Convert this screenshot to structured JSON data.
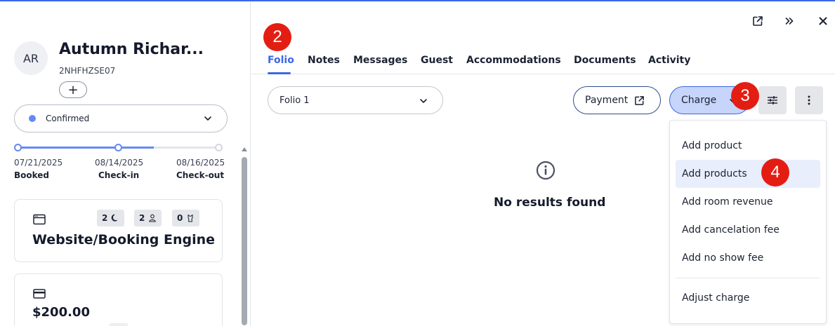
{
  "reservation": {
    "avatar_initials": "AR",
    "guest_name": "Autumn Richar...",
    "booking_code": "2NHFHZSE07",
    "add_label": "+",
    "status": {
      "label": "Confirmed",
      "color": "#6689f2"
    },
    "timeline": {
      "progress_fraction": 0.67,
      "booked_date": "07/21/2025",
      "booked_label": "Booked",
      "checkin_date": "08/14/2025",
      "checkin_label": "Check-in",
      "checkout_date": "08/16/2025",
      "checkout_label": "Check-out"
    },
    "source_card": {
      "nights": "2",
      "guests": "2",
      "pets": "0",
      "title": "Website/Booking Engine"
    },
    "amount_card": {
      "amount": "$200.00"
    }
  },
  "header_icons": [
    "open-external-icon",
    "collapse-panel-icon",
    "close-icon"
  ],
  "tabs": [
    {
      "label": "Folio",
      "active": true
    },
    {
      "label": "Notes"
    },
    {
      "label": "Messages"
    },
    {
      "label": "Guest"
    },
    {
      "label": "Accommodations"
    },
    {
      "label": "Documents"
    },
    {
      "label": "Activity"
    }
  ],
  "toolbar": {
    "folio_selected": "Folio 1",
    "payment_label": "Payment",
    "charge_label": "Charge"
  },
  "empty_state": {
    "text": "No results found"
  },
  "charge_menu": {
    "items": [
      "Add product",
      "Add products",
      "Add room revenue",
      "Add cancelation fee",
      "Add no show fee"
    ],
    "highlighted_index": 1,
    "footer_item": "Adjust charge"
  },
  "markers": {
    "m2": "2",
    "m3": "3",
    "m4": "4"
  },
  "colors": {
    "accent": "#3b66e6",
    "charge_bg": "#c7d5fb",
    "marker": "#e41d12"
  }
}
